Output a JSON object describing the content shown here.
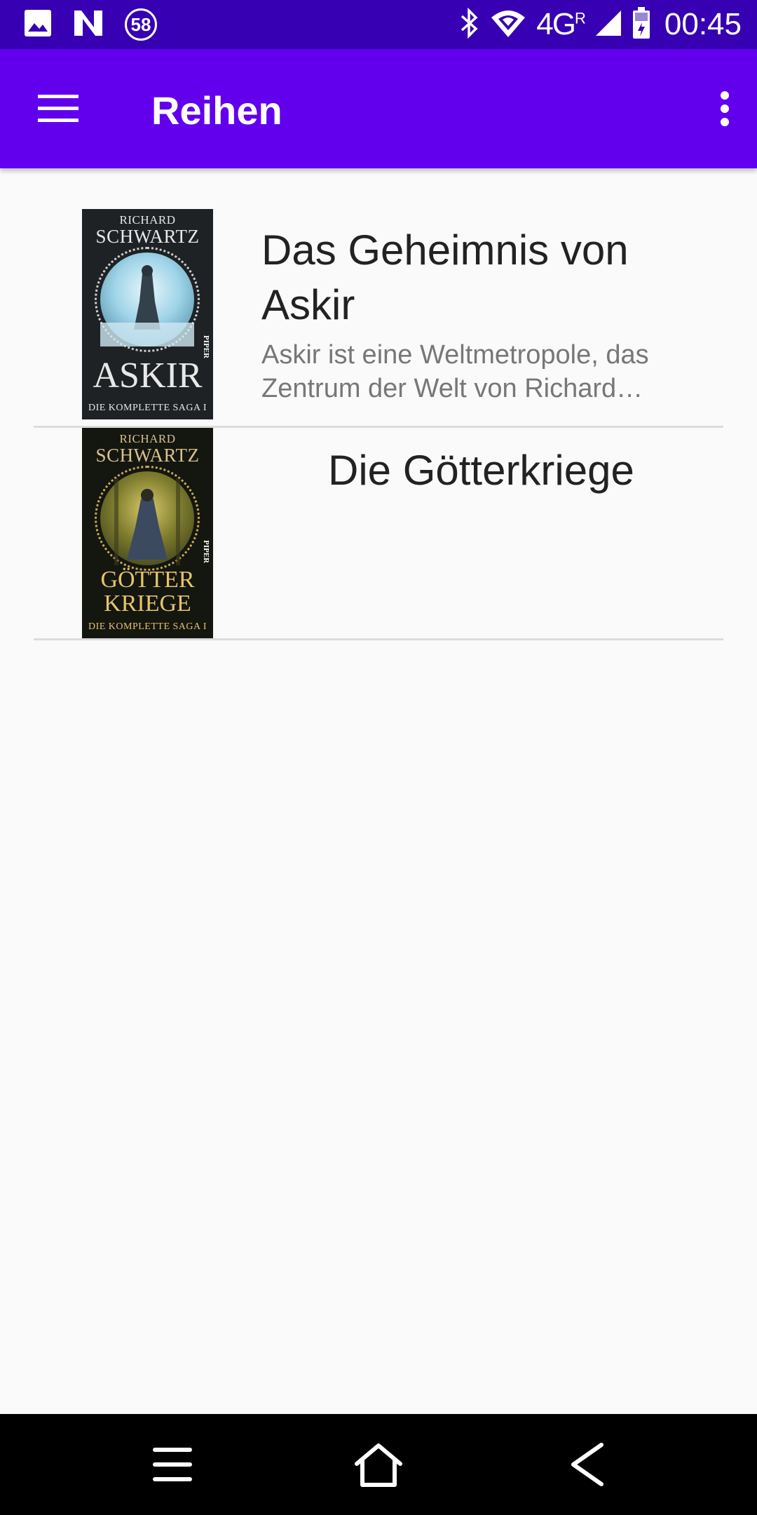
{
  "status_bar": {
    "notification_icons": [
      "image-icon",
      "n-logo-icon",
      "count-badge-icon"
    ],
    "badge_count": "58",
    "bluetooth_icon": "bluetooth-icon",
    "wifi_icon": "wifi-icon",
    "network_type": "4G",
    "network_suffix": "R",
    "signal_icon": "signal-icon",
    "battery_icon": "battery-charging-icon",
    "time": "00:45"
  },
  "app_bar": {
    "menu_icon": "hamburger-menu-icon",
    "title": "Reihen",
    "more_icon": "more-vert-icon",
    "color": "#6200ee"
  },
  "series": [
    {
      "title": "Das Geheimnis von Askir",
      "description": "Askir ist eine Weltmetropole, das Zentrum der Welt von Richard Schwartz",
      "cover": {
        "author_first": "RICHARD",
        "author_last": "SCHWARTZ",
        "book_title": "ASKIR",
        "subtitle": "DIE KOMPLETTE SAGA I",
        "publisher": "PIPER"
      }
    },
    {
      "title": "Die Götterkriege",
      "description": "",
      "cover": {
        "author_first": "RICHARD",
        "author_last": "SCHWARTZ",
        "book_title_line1": "GÖTTER",
        "book_title_line2": "KRIEGE",
        "subtitle": "DIE KOMPLETTE SAGA I",
        "publisher": "PIPER"
      }
    }
  ],
  "nav_bar": {
    "recents_icon": "recents-icon",
    "home_icon": "home-icon",
    "back_icon": "back-icon"
  },
  "colors": {
    "status_bar": "#3700b3",
    "app_bar": "#6200ee",
    "background": "#fafafa",
    "divider": "#dcdcdc"
  }
}
